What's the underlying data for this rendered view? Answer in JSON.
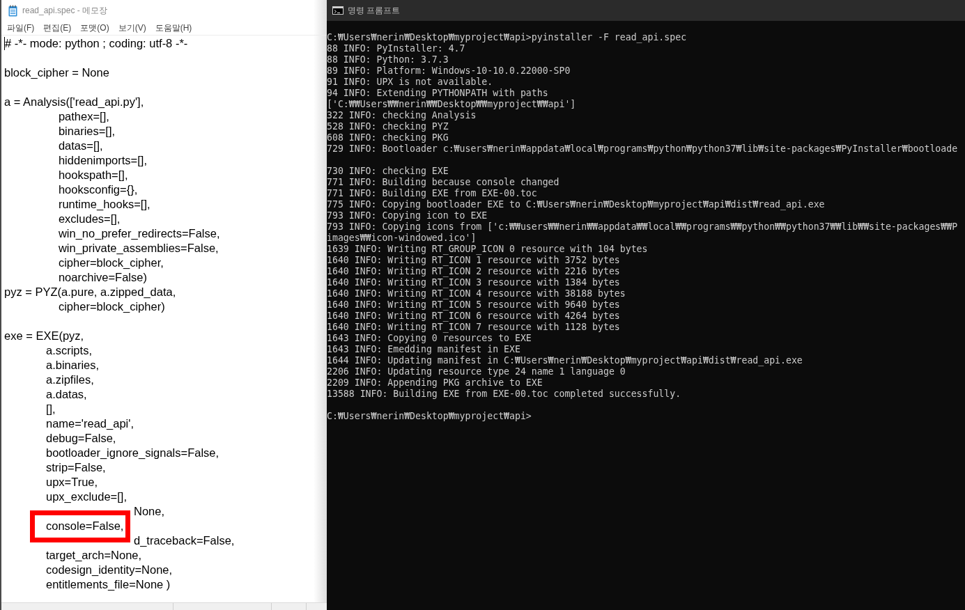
{
  "notepad": {
    "title": "read_api.spec - 메모장",
    "menu": [
      {
        "label": "파일(F)"
      },
      {
        "label": "편집(E)"
      },
      {
        "label": "포맷(O)"
      },
      {
        "label": "보기(V)"
      },
      {
        "label": "도움말(H)"
      }
    ],
    "editor": {
      "cursor_at_start": true,
      "blocks": [
        {
          "lines": [
            {
              "kind": "code",
              "text": "# -*- mode: python ; coding: utf-8 -*-"
            }
          ]
        },
        {
          "lines": [
            {
              "kind": "code",
              "text": "block_cipher = None"
            }
          ]
        },
        {
          "lines": [
            {
              "kind": "code",
              "text": "a = Analysis(['read_api.py'],"
            },
            {
              "kind": "code",
              "text": "             pathex=[],"
            },
            {
              "kind": "code",
              "text": "             binaries=[],"
            },
            {
              "kind": "code",
              "text": "             datas=[],"
            },
            {
              "kind": "code",
              "text": "             hiddenimports=[],"
            },
            {
              "kind": "code",
              "text": "             hookspath=[],"
            },
            {
              "kind": "code",
              "text": "             hooksconfig={},"
            },
            {
              "kind": "code",
              "text": "             runtime_hooks=[],"
            },
            {
              "kind": "code",
              "text": "             excludes=[],"
            },
            {
              "kind": "code",
              "text": "             win_no_prefer_redirects=False,"
            },
            {
              "kind": "code",
              "text": "             win_private_assemblies=False,"
            },
            {
              "kind": "code",
              "text": "             cipher=block_cipher,"
            },
            {
              "kind": "code",
              "text": "             noarchive=False)"
            },
            {
              "kind": "code",
              "text": "pyz = PYZ(a.pure, a.zipped_data,"
            },
            {
              "kind": "code",
              "text": "             cipher=block_cipher)"
            }
          ]
        },
        {
          "lines": [
            {
              "kind": "code",
              "text": "exe = EXE(pyz,"
            },
            {
              "kind": "code",
              "text": "          a.scripts,"
            },
            {
              "kind": "code",
              "text": "          a.binaries,"
            },
            {
              "kind": "code",
              "text": "          a.zipfiles,"
            },
            {
              "kind": "code",
              "text": "          a.datas,"
            },
            {
              "kind": "code",
              "text": "          [],"
            },
            {
              "kind": "code",
              "text": "          name='read_api',"
            },
            {
              "kind": "code",
              "text": "          debug=False,"
            },
            {
              "kind": "code",
              "text": "          bootloader_ignore_signals=False,"
            },
            {
              "kind": "code",
              "text": "          strip=False,"
            },
            {
              "kind": "code",
              "text": "          upx=True,"
            },
            {
              "kind": "code",
              "text": "          upx_exclude=[],"
            },
            {
              "kind": "covered",
              "text": "None,"
            },
            {
              "kind": "boxed",
              "text": "          console=False,"
            },
            {
              "kind": "covered",
              "text": "d_traceback=False,"
            },
            {
              "kind": "code",
              "text": "          target_arch=None,"
            },
            {
              "kind": "code",
              "text": "          codesign_identity=None,"
            },
            {
              "kind": "code",
              "text": "          entitlements_file=None )"
            }
          ]
        }
      ]
    }
  },
  "terminal": {
    "title": "명령 프롬프트",
    "blocks": [
      {
        "lines": [
          "C:₩Users₩nerin₩Desktop₩myproject₩api>pyinstaller -F read_api.spec",
          "88 INFO: PyInstaller: 4.7",
          "88 INFO: Python: 3.7.3",
          "89 INFO: Platform: Windows-10-10.0.22000-SP0",
          "91 INFO: UPX is not available.",
          "94 INFO: Extending PYTHONPATH with paths",
          "['C:₩₩Users₩₩nerin₩₩Desktop₩₩myproject₩₩api']",
          "322 INFO: checking Analysis",
          "528 INFO: checking PYZ",
          "608 INFO: checking PKG",
          "729 INFO: Bootloader c:₩users₩nerin₩appdata₩local₩programs₩python₩python37₩lib₩site-packages₩PyInstaller₩bootloade"
        ]
      },
      {
        "lines": [
          "730 INFO: checking EXE",
          "771 INFO: Building because console changed",
          "771 INFO: Building EXE from EXE-00.toc",
          "775 INFO: Copying bootloader EXE to C:₩Users₩nerin₩Desktop₩myproject₩api₩dist₩read_api.exe",
          "793 INFO: Copying icon to EXE",
          "793 INFO: Copying icons from ['c:₩₩users₩₩nerin₩₩appdata₩₩local₩₩programs₩₩python₩₩python37₩₩lib₩₩site-packages₩₩P",
          "images₩₩icon-windowed.ico']",
          "1639 INFO: Writing RT_GROUP_ICON 0 resource with 104 bytes",
          "1640 INFO: Writing RT_ICON 1 resource with 3752 bytes",
          "1640 INFO: Writing RT_ICON 2 resource with 2216 bytes",
          "1640 INFO: Writing RT_ICON 3 resource with 1384 bytes",
          "1640 INFO: Writing RT_ICON 4 resource with 38188 bytes",
          "1640 INFO: Writing RT_ICON 5 resource with 9640 bytes",
          "1640 INFO: Writing RT_ICON 6 resource with 4264 bytes",
          "1640 INFO: Writing RT_ICON 7 resource with 1128 bytes",
          "1643 INFO: Copying 0 resources to EXE",
          "1643 INFO: Emedding manifest in EXE",
          "1644 INFO: Updating manifest in C:₩Users₩nerin₩Desktop₩myproject₩api₩dist₩read_api.exe",
          "2206 INFO: Updating resource type 24 name 1 language 0",
          "2209 INFO: Appending PKG archive to EXE",
          "13588 INFO: Building EXE from EXE-00.toc completed successfully."
        ]
      },
      {
        "lines": [
          "C:₩Users₩nerin₩Desktop₩myproject₩api>"
        ]
      }
    ]
  }
}
